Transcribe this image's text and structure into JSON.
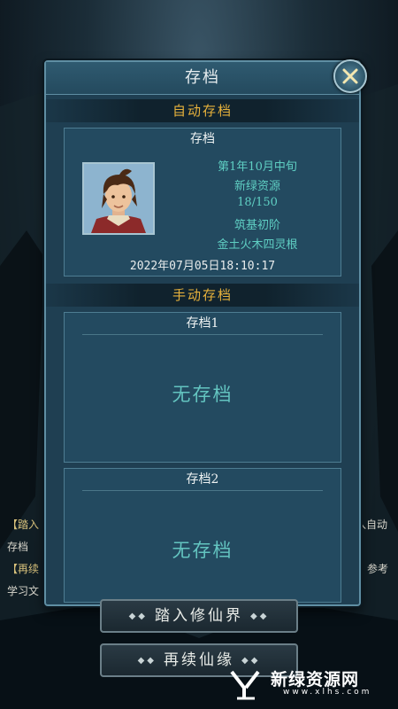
{
  "dialog": {
    "title": "存档",
    "auto_section": "自动存档",
    "manual_section": "手动存档",
    "auto_slot": {
      "header": "存档",
      "date": "第1年10月中旬",
      "name": "新绿资源",
      "progress": "18/150",
      "realm": "筑基初阶",
      "root": "金土火木四灵根",
      "datetime": "2022年07月05日18:10:17"
    },
    "manual_slots": [
      {
        "header": "存档1",
        "status": "无存档"
      },
      {
        "header": "存档2",
        "status": "无存档"
      }
    ]
  },
  "background_text": {
    "left1": "【踏入",
    "left2": "存档",
    "left3": "【再续",
    "left4": "学习文",
    "right1": "入自动",
    "right2": "参考"
  },
  "menu": {
    "enter": "踏入修仙界",
    "continue": "再续仙缘"
  },
  "watermark": {
    "cn": "新绿资源网",
    "en": "www.xlhs.com"
  },
  "colors": {
    "accent_gold": "#e6b13c",
    "teal_text": "#5fcfc3",
    "panel": "#1f3f52"
  }
}
